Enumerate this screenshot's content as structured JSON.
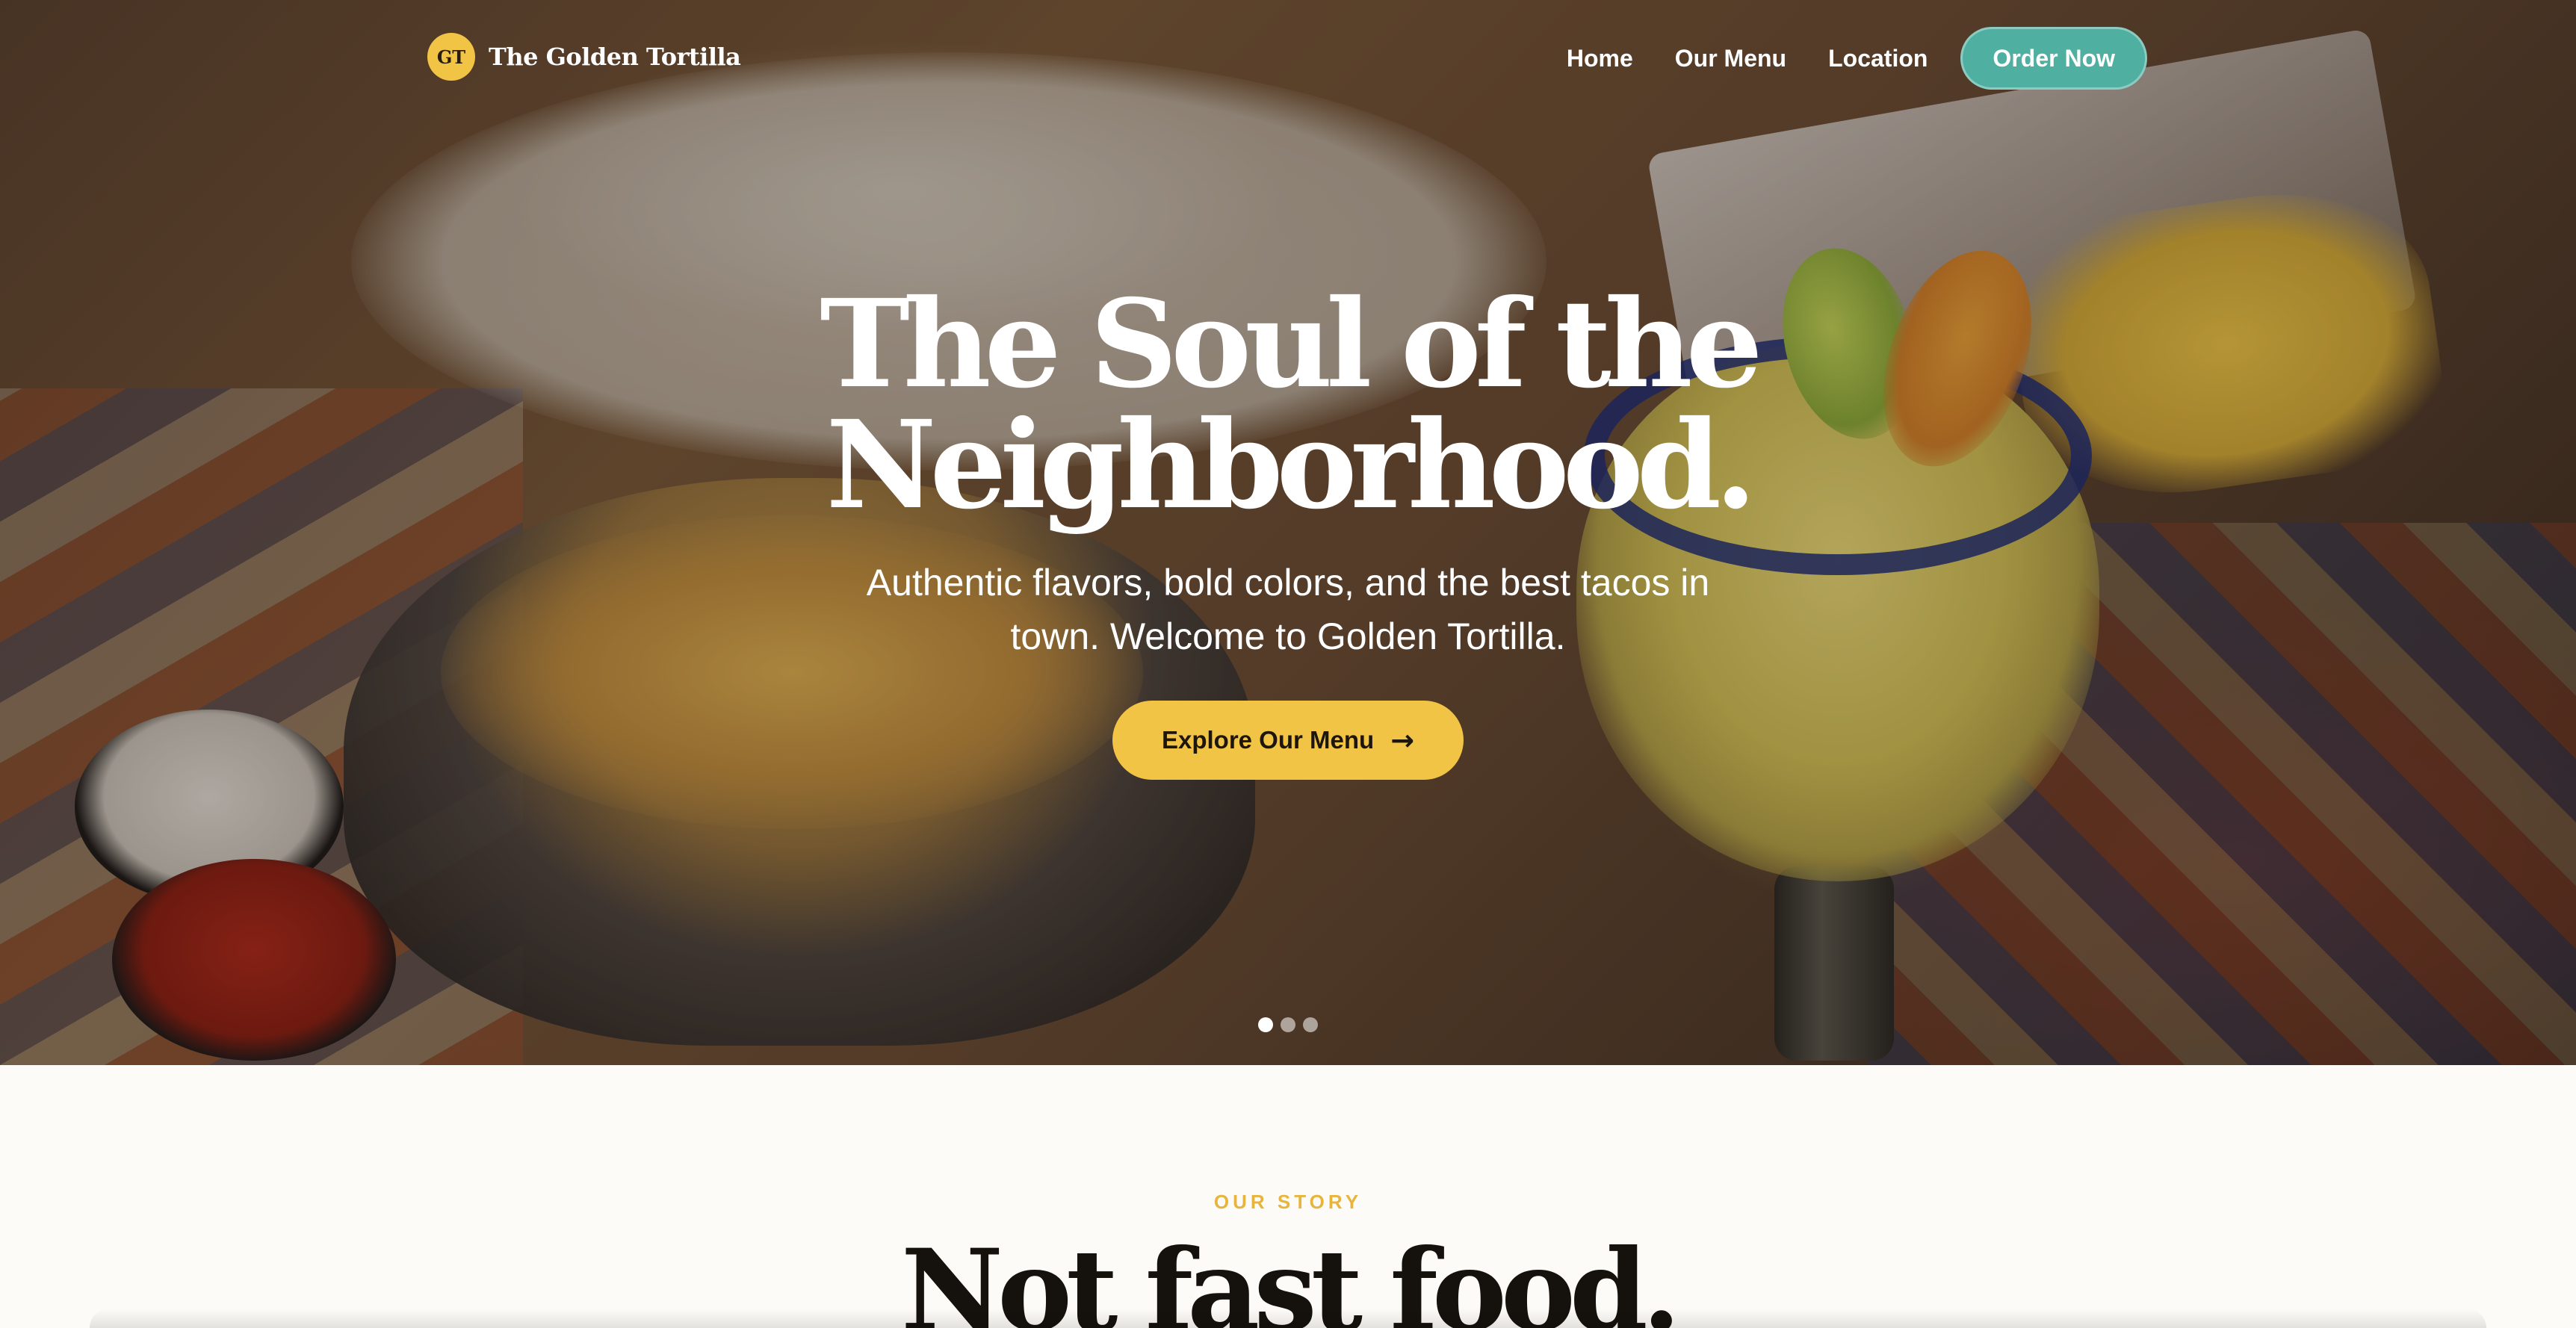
{
  "nav": {
    "brand_initials": "GT",
    "brand_name": "The Golden Tortilla",
    "links": [
      "Home",
      "Our Menu",
      "Location"
    ],
    "order_label": "Order Now"
  },
  "hero": {
    "title_lines": [
      "The Soul of the",
      "Neighborhood."
    ],
    "subtitle_lines": [
      "Authentic flavors, bold colors, and the best tacos in",
      "town. Welcome to Golden Tortilla."
    ],
    "cta_label": "Explore Our Menu",
    "cta_icon": "arrow-right-icon",
    "cta_arrow": "→",
    "slides": {
      "count": 3,
      "active": 1
    }
  },
  "story": {
    "eyebrow": "OUR STORY",
    "title": "Not fast food."
  },
  "colors": {
    "accent_gold": "#f2c445",
    "accent_teal": "#4fb0a2",
    "page_background": "#fcfbf7",
    "heading_dark": "#15110c"
  }
}
